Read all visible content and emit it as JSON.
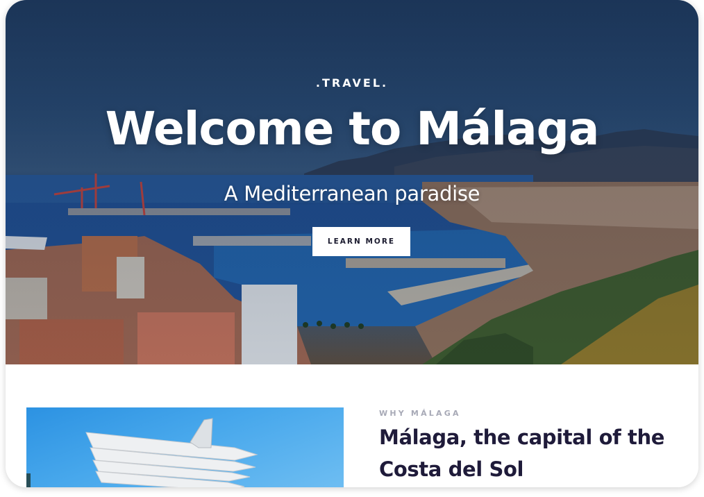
{
  "hero": {
    "eyebrow": ".TRAVEL.",
    "title": "Welcome to Málaga",
    "subtitle": "A Mediterranean paradise",
    "button_label": "LEARN MORE",
    "image_alt_icon": "city-port-photo"
  },
  "intro": {
    "eyebrow": "WHY MÁLAGA",
    "title": "Málaga, the capital of the Costa del Sol",
    "image_icon": "modern-building-photo"
  },
  "colors": {
    "title_dark": "#1f1b3a",
    "eyebrow_gray": "#a7a9b6",
    "button_bg": "#ffffff",
    "hero_overlay": "#1f3d63"
  }
}
